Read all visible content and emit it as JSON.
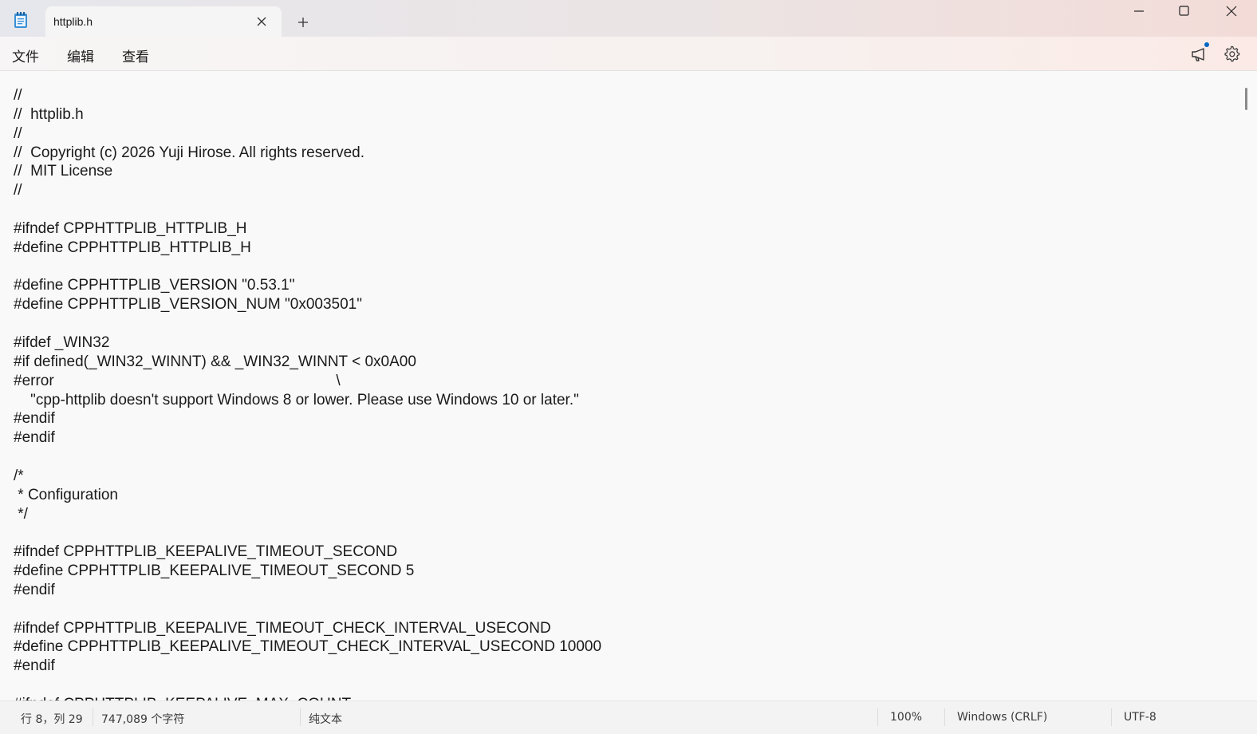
{
  "tab": {
    "title": "httplib.h"
  },
  "menu": {
    "file": "文件",
    "edit": "编辑",
    "view": "查看"
  },
  "editor": {
    "lines": [
      "//",
      "//  httplib.h",
      "//",
      "//  Copyright (c) 2026 Yuji Hirose. All rights reserved.",
      "//  MIT License",
      "//",
      "",
      "#ifndef CPPHTTPLIB_HTTPLIB_H",
      "#define CPPHTTPLIB_HTTPLIB_H",
      "",
      "#define CPPHTTPLIB_VERSION \"0.53.1\"",
      "#define CPPHTTPLIB_VERSION_NUM \"0x003501\"",
      "",
      "#ifdef _WIN32",
      "#if defined(_WIN32_WINNT) && _WIN32_WINNT < 0x0A00",
      "#error                                                                   \\",
      "    \"cpp-httplib doesn't support Windows 8 or lower. Please use Windows 10 or later.\"",
      "#endif",
      "#endif",
      "",
      "/*",
      " * Configuration",
      " */",
      "",
      "#ifndef CPPHTTPLIB_KEEPALIVE_TIMEOUT_SECOND",
      "#define CPPHTTPLIB_KEEPALIVE_TIMEOUT_SECOND 5",
      "#endif",
      "",
      "#ifndef CPPHTTPLIB_KEEPALIVE_TIMEOUT_CHECK_INTERVAL_USECOND",
      "#define CPPHTTPLIB_KEEPALIVE_TIMEOUT_CHECK_INTERVAL_USECOND 10000",
      "#endif",
      "",
      "#ifndef CPPHTTPLIB_KEEPALIVE_MAX_COUNT"
    ]
  },
  "status": {
    "position": "行 8，列 29",
    "char_count": "747,089 个字符",
    "format": "纯文本",
    "zoom": "100%",
    "line_ending": "Windows (CRLF)",
    "encoding": "UTF-8"
  }
}
